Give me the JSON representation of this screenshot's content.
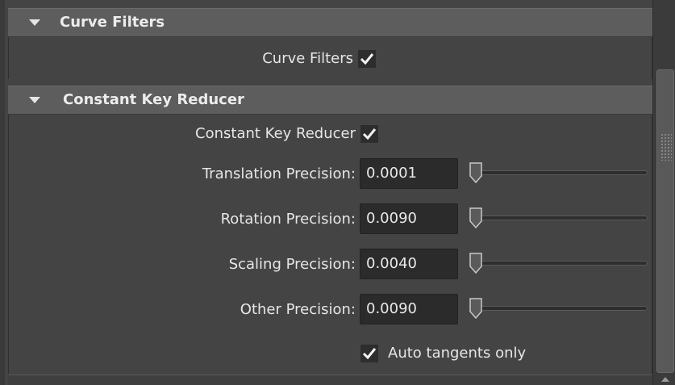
{
  "curve_filters": {
    "header_title": "Curve Filters",
    "checkbox_label": "Curve Filters",
    "checked": true
  },
  "constant_key_reducer": {
    "header_title": "Constant Key Reducer",
    "checkbox_label": "Constant Key Reducer",
    "checked": true,
    "fields": [
      {
        "label": "Translation Precision:",
        "value": "0.0001"
      },
      {
        "label": "Rotation Precision:",
        "value": "0.0090"
      },
      {
        "label": "Scaling Precision:",
        "value": "0.0040"
      },
      {
        "label": "Other Precision:",
        "value": "0.0090"
      }
    ],
    "auto_tangents": {
      "label": "Auto tangents only",
      "checked": true
    }
  }
}
